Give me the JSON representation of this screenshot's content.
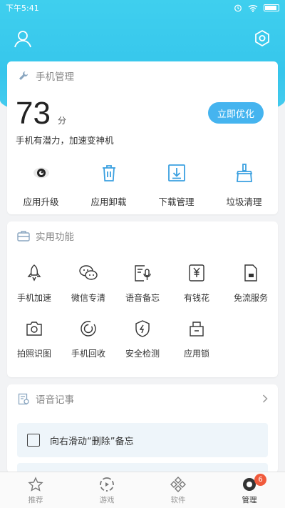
{
  "status": {
    "time": "下午5:41"
  },
  "colors": {
    "accent": "#45b4ef",
    "hero": "#3fcfee",
    "badge": "#f05a3c"
  },
  "phone_manage": {
    "title": "手机管理",
    "score": "73",
    "unit": "分",
    "subtitle": "手机有潜力，加速变神机",
    "optimize_label": "立即优化",
    "actions": [
      {
        "label": "应用升级",
        "icon": "app-upgrade-icon"
      },
      {
        "label": "应用卸载",
        "icon": "trash-icon"
      },
      {
        "label": "下载管理",
        "icon": "download-icon"
      },
      {
        "label": "垃圾清理",
        "icon": "broom-icon"
      }
    ]
  },
  "utilities": {
    "title": "实用功能",
    "items": [
      {
        "label": "手机加速",
        "icon": "rocket-icon"
      },
      {
        "label": "微信专清",
        "icon": "wechat-icon"
      },
      {
        "label": "语音备忘",
        "icon": "voice-memo-icon"
      },
      {
        "label": "有钱花",
        "icon": "yuan-icon"
      },
      {
        "label": "免流服务",
        "icon": "sim-card-icon"
      },
      {
        "label": "拍照识图",
        "icon": "camera-icon"
      },
      {
        "label": "手机回收",
        "icon": "recycle-icon"
      },
      {
        "label": "安全检测",
        "icon": "shield-icon"
      },
      {
        "label": "应用锁",
        "icon": "lock-icon"
      }
    ]
  },
  "voice_notes": {
    "title": "语音记事",
    "item": "向右滑动“删除”备忘"
  },
  "tabs": [
    {
      "label": "推荐",
      "icon": "star-icon"
    },
    {
      "label": "游戏",
      "icon": "game-icon"
    },
    {
      "label": "软件",
      "icon": "software-icon"
    },
    {
      "label": "管理",
      "icon": "manage-icon",
      "badge": "6",
      "active": true
    }
  ]
}
